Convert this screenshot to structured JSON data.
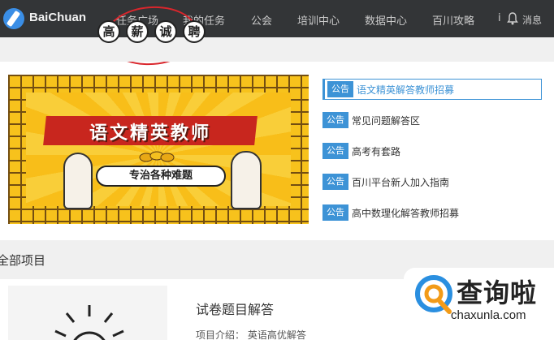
{
  "header": {
    "brand": "BaiChuan",
    "nav": [
      "任务广场",
      "我的任务",
      "公会",
      "培训中心",
      "数据中心",
      "百川攻略"
    ],
    "info_glyph": "i",
    "message_label": "消息"
  },
  "banner": {
    "hire_chars": [
      "高",
      "薪",
      "诚",
      "聘"
    ],
    "title": "语文精英教师",
    "subtitle": "专治各种难题"
  },
  "announcements": {
    "tag": "公告",
    "items": [
      "语文精英解答教师招募",
      "常见问题解答区",
      "高考有套路",
      "百川平台新人加入指南",
      "高中数理化解答教师招募"
    ]
  },
  "section": {
    "title": "全部项目"
  },
  "project": {
    "title": "试卷题目解答",
    "intro_label": "项目介绍：",
    "intro_value": "英语高优解答"
  },
  "watermark": {
    "cn": "查询啦",
    "en": "chaxunla.com"
  },
  "colors": {
    "topbar": "#333537",
    "accent_blue": "#3d93d6",
    "annotation_red": "#d9262c",
    "banner_yellow": "#f7c21c",
    "ribbon_red": "#c8261e"
  },
  "icons": [
    "logo-icon",
    "info-icon",
    "bell-icon",
    "sun-icon",
    "search-logo-icon"
  ]
}
